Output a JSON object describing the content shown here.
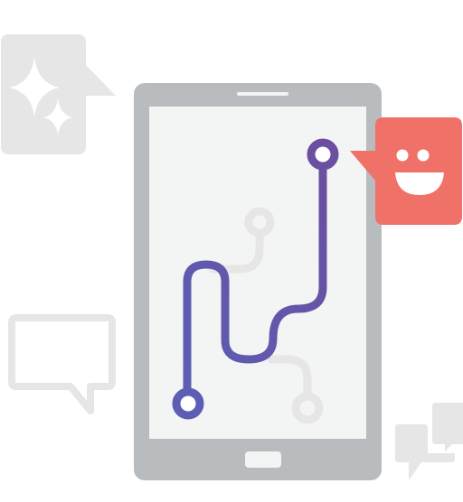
{
  "illustration": {
    "icons": {
      "sparkle_bubble": "sparkle-chat-bubble-icon",
      "phone": "smartphone-icon",
      "route": "route-path-icon",
      "smiley_bubble": "smiley-chat-bubble-icon",
      "outline_bubble": "outline-chat-bubble-icon",
      "double_bubble": "double-chat-bubble-icon"
    },
    "colors": {
      "background": "#ffffff",
      "phone_body": "#b8bcbe",
      "phone_screen": "#f3f4f4",
      "phone_button": "#f3f4f4",
      "decor_gray": "#e6e6e6",
      "route_start": "#5b5eb4",
      "route_end": "#6b4fa0",
      "smiley_bubble": "#f07167",
      "smiley_face": "#ffffff"
    }
  }
}
